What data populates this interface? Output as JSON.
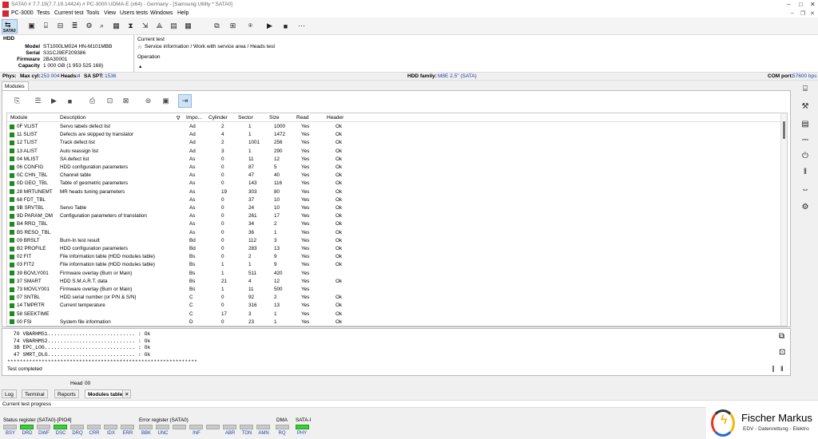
{
  "titlebar": {
    "title": "SATA0 # 7.7.19(7.7.19.14424) # PC-3000 UDMA-E (x64) - Germany - [Samsung Utility * SATA0]"
  },
  "menu": {
    "pc3000": "PC-3000",
    "tests": "Tests",
    "current_test": "Current test",
    "tools": "Tools",
    "view": "View",
    "user_tests": "Users tests",
    "windows": "Windows",
    "help": "Help"
  },
  "toolbar": {
    "sata_label": "SATA0"
  },
  "hdd": {
    "section": "HDD",
    "model_label": "Model",
    "model": "ST1000LM024 HN-M101MBB",
    "serial_label": "Serial",
    "serial": "S31CJ9EF209386",
    "firmware_label": "Firmware",
    "firmware": "2BA30001",
    "capacity_label": "Capacity",
    "capacity": "1 000 GB (1 953 525 168)"
  },
  "current_test": {
    "label": "Current test",
    "value": "Service information / Work with service area / Heads test",
    "operation_label": "Operation"
  },
  "phys": {
    "label": "Phys:",
    "maxcyl_label": "Max cyl:",
    "maxcyl": "253 004",
    "heads_label": "Heads:",
    "heads": "4",
    "spt_label": "SA SPT:",
    "spt": "1536",
    "family_label": "HDD family:",
    "family": "M8E 2.5\" (SATA)",
    "com_label": "COM port:",
    "com": "57600 bps"
  },
  "modules_tab": "Modules",
  "columns": {
    "module": "Module",
    "description": "Description",
    "importance": "Impo...",
    "cylinder": "Cylinder",
    "sector": "Sector",
    "size": "Size",
    "read": "Read",
    "header": "Header"
  },
  "rows": [
    [
      "0F VLIST",
      "Servo labels defect list",
      "Ad",
      "2",
      "1",
      "1000",
      "Yes",
      "Ok"
    ],
    [
      "11 SLIST",
      "Defects are skipped by translator",
      "Ad",
      "4",
      "1",
      "1472",
      "Yes",
      "Ok"
    ],
    [
      "12 TLIST",
      "Track defect list",
      "Ad",
      "2",
      "1001",
      "256",
      "Yes",
      "Ok"
    ],
    [
      "13 ALIST",
      "Auto reassign list",
      "Ad",
      "3",
      "1",
      "290",
      "Yes",
      "Ok"
    ],
    [
      "04 MLIST",
      "SA defect list",
      "As",
      "0",
      "11",
      "12",
      "Yes",
      "Ok"
    ],
    [
      "06 CONFIG",
      "HDD configuration parameters",
      "As",
      "0",
      "87",
      "5",
      "Yes",
      "Ok"
    ],
    [
      "0C CHN_TBL",
      "Channel table",
      "As",
      "0",
      "47",
      "40",
      "Yes",
      "Ok"
    ],
    [
      "0D GEO_TBL",
      "Table of geometric parameters",
      "As",
      "0",
      "143",
      "116",
      "Yes",
      "Ok"
    ],
    [
      "28 MRTUNEMT",
      "MR heads tuning parameters",
      "As",
      "19",
      "303",
      "80",
      "Yes",
      "Ok"
    ],
    [
      "68 FDT_TBL",
      "",
      "As",
      "0",
      "37",
      "10",
      "Yes",
      "Ok"
    ],
    [
      "9B SRVTBL",
      "Servo Table",
      "As",
      "0",
      "24",
      "10",
      "Yes",
      "Ok"
    ],
    [
      "9D PARAM_DM",
      "Configuration parameters of translation",
      "As",
      "0",
      "261",
      "17",
      "Yes",
      "Ok"
    ],
    [
      "B4 RRO_TBL",
      "",
      "As",
      "0",
      "34",
      "2",
      "Yes",
      "Ok"
    ],
    [
      "B5 RESO_TBL",
      "",
      "As",
      "0",
      "36",
      "1",
      "Yes",
      "Ok"
    ],
    [
      "09 BRSLT",
      "Burn-In test result",
      "Bd",
      "0",
      "112",
      "3",
      "Yes",
      "Ok"
    ],
    [
      "B2 PROFILE",
      "HDD configuration parameters",
      "Bd",
      "0",
      "283",
      "13",
      "Yes",
      "Ok"
    ],
    [
      "02 FIT",
      "File information table (HDD modules table)",
      "Bs",
      "0",
      "2",
      "9",
      "Yes",
      "Ok"
    ],
    [
      "03 FIT2",
      "File information table (HDD modules table)",
      "Bs",
      "1",
      "1",
      "9",
      "Yes",
      "Ok"
    ],
    [
      "39 BOVLY001",
      "Firmware overlay (Burn or Main)",
      "Bs",
      "1",
      "511",
      "420",
      "Yes",
      ""
    ],
    [
      "37 SMART",
      "HDD S.M.A.R.T. data",
      "Bs",
      "21",
      "4",
      "12",
      "Yes",
      "Ok"
    ],
    [
      "73 MOVLY001",
      "Firmware overlay (Burn or Main)",
      "Bs",
      "1",
      "11",
      "500",
      "Yes",
      ""
    ],
    [
      "07 SNTBL",
      "HDD serial number (or P/N & S/N)",
      "C",
      "0",
      "92",
      "2",
      "Yes",
      "Ok"
    ],
    [
      "14 TMPRTR",
      "Current temperature",
      "C",
      "0",
      "316",
      "13",
      "Yes",
      "Ok"
    ],
    [
      "58 SEEKTIME",
      "",
      "C",
      "17",
      "3",
      "1",
      "Yes",
      "Ok"
    ],
    [
      "00 FSI",
      "System file information",
      "D",
      "0",
      "23",
      "1",
      "Yes",
      "Ok"
    ]
  ],
  "log": {
    "lines": [
      "  70 VBARHMS1............................ : Ok",
      "  74 VBARHMS2............................ : Ok",
      "  3B EPC_LOG............................. : Ok",
      "  47 SMRT_DLG............................ : Ok",
      "*************************************************************",
      "Test completed"
    ]
  },
  "head_label": "Head",
  "head_value": "00",
  "bottom_tabs": {
    "log": "Log",
    "terminal": "Terminal",
    "reports": "Reports",
    "modules_table": "Modules table"
  },
  "progress_label": "Current test progress",
  "status_register": {
    "label": "Status register (SATA0)-[PIO4]",
    "bits": [
      "BSY",
      "DRD",
      "DWF",
      "DSC",
      "DRQ",
      "CRR",
      "IDX",
      "ERR"
    ],
    "on": [
      false,
      true,
      false,
      true,
      false,
      false,
      false,
      false
    ]
  },
  "error_register": {
    "label": "Error register (SATA0)",
    "bits": [
      "BBK",
      "UNC",
      "",
      "INF",
      "",
      "ABR",
      "TON",
      "AMN"
    ]
  },
  "dma": {
    "label": "DMA",
    "bit": "RQ"
  },
  "sata_i": {
    "label": "SATA-I",
    "bit": "PHY"
  },
  "logo": {
    "name": "Fischer Markus",
    "tagline": "EDV - Datenrettung - Elektro"
  },
  "colors": {
    "accent": "#1f3fa6",
    "led_on": "#37d037",
    "module_ok": "#1c8a1c"
  }
}
